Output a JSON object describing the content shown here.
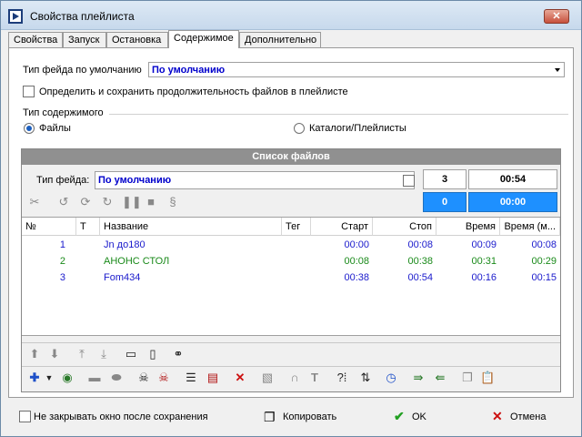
{
  "window": {
    "title": "Свойства плейлиста",
    "close_glyph": "✕"
  },
  "tabs": [
    {
      "label": "Свойства"
    },
    {
      "label": "Запуск"
    },
    {
      "label": "Остановка"
    },
    {
      "label": "Содержимое"
    },
    {
      "label": "Дополнительно"
    }
  ],
  "content": {
    "feed_type_label": "Тип фейда по умолчанию",
    "feed_type_value": "По умолчанию",
    "save_duration_label": "Определить и сохранить продолжительность файлов в плейлисте",
    "content_type_label": "Тип содержимого",
    "radio_files": "Файлы",
    "radio_catalogs": "Каталоги/Плейлисты"
  },
  "file_list": {
    "header": "Список файлов",
    "feed_label": "Тип фейда:",
    "feed_value": "По умолчанию",
    "count": "3",
    "total_time": "00:54",
    "selected_count": "0",
    "selected_time": "00:00",
    "columns": [
      "№",
      "Т",
      "Название",
      "Тег",
      "Старт",
      "Стоп",
      "Время",
      "Время (м..."
    ],
    "rows": [
      {
        "num": "1",
        "name": "Jn до180",
        "start": "00:00",
        "stop": "00:08",
        "time": "00:09",
        "time_m": "00:08",
        "color": "#1a1acc"
      },
      {
        "num": "2",
        "name": "АНОНС СТОЛ",
        "start": "00:08",
        "stop": "00:38",
        "time": "00:31",
        "time_m": "00:29",
        "color": "#1a8a1a"
      },
      {
        "num": "3",
        "name": "Fom434",
        "start": "00:38",
        "stop": "00:54",
        "time": "00:16",
        "time_m": "00:15",
        "color": "#1a1acc"
      }
    ]
  },
  "footer": {
    "keep_open_label": "Не закрывать окно после сохранения",
    "copy_label": "Копировать",
    "ok_label": "OK",
    "cancel_label": "Отмена"
  },
  "colors": {
    "accent_blue": "#1e90ff",
    "link_blue": "#0000cc",
    "green": "#1a8a1a"
  }
}
